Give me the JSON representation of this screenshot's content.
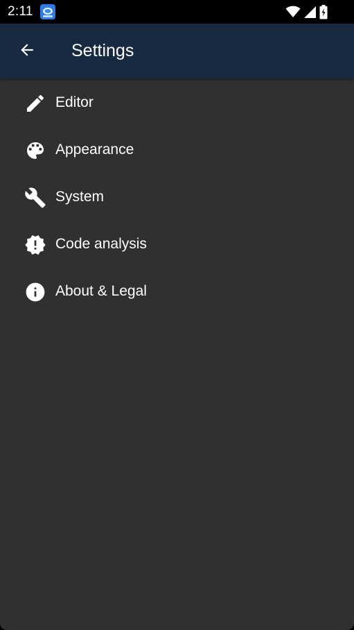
{
  "status_bar": {
    "time": "2:11",
    "icons": [
      "app-notification-icon",
      "wifi-icon",
      "signal-icon",
      "battery-charging-icon"
    ]
  },
  "app_bar": {
    "back_icon": "arrow-back-icon",
    "title": "Settings"
  },
  "settings": {
    "items": [
      {
        "label": "Editor",
        "icon": "pencil-icon"
      },
      {
        "label": "Appearance",
        "icon": "palette-icon"
      },
      {
        "label": "System",
        "icon": "wrench-icon"
      },
      {
        "label": "Code analysis",
        "icon": "alert-decagram-icon"
      },
      {
        "label": "About & Legal",
        "icon": "info-icon"
      }
    ]
  },
  "colors": {
    "status_bar_bg": "#000000",
    "app_bar_bg": "#172a41",
    "background": "#303030",
    "text": "#ffffff"
  }
}
